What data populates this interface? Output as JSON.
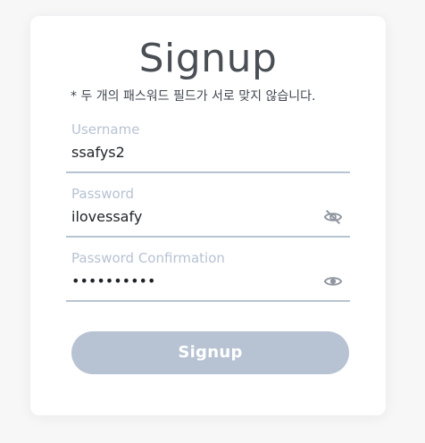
{
  "form": {
    "title": "Signup",
    "warning": "* 두 개의 패스워드 필드가 서로 맞지 않습니다.",
    "username": {
      "label": "Username",
      "value": "ssafys2"
    },
    "password": {
      "label": "Password",
      "value": "ilovessafy",
      "visibility_icon": "eye-off-icon"
    },
    "password_confirmation": {
      "label": "Password Confirmation",
      "value": "••••••••••",
      "visibility_icon": "eye-icon"
    },
    "submit_label": "Signup",
    "colors": {
      "accent_disabled": "#b7c3d3",
      "label": "#b7c2d3",
      "text": "#1f2328"
    }
  }
}
